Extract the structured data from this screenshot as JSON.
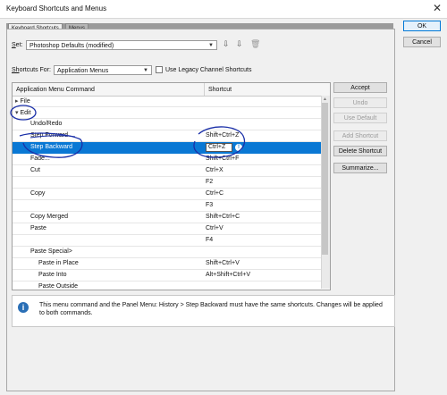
{
  "window": {
    "title": "Keyboard Shortcuts and Menus"
  },
  "tabs": [
    {
      "label": "Keyboard Shortcuts"
    },
    {
      "label": "Menus"
    }
  ],
  "set": {
    "label_prefix": "S",
    "label_rest": "et:",
    "value": "Photoshop Defaults (modified)"
  },
  "shortcuts_for": {
    "label_prefix": "Sh",
    "label_rest": "ortcuts For:",
    "value": "Application Menus",
    "legacy_label": "Use Legacy Channel Shortcuts"
  },
  "table": {
    "col_command": "Application Menu Command",
    "col_shortcut": "Shortcut",
    "rows": [
      {
        "cmd": "File",
        "sc": "",
        "indent": 0,
        "group": "collapsed"
      },
      {
        "cmd": "Edit",
        "sc": "",
        "indent": 0,
        "group": "expanded"
      },
      {
        "cmd": "Undo/Redo",
        "sc": "",
        "indent": 1
      },
      {
        "cmd": "Step Forward",
        "sc": "Shift+Ctrl+Z",
        "indent": 1
      },
      {
        "cmd": "Step Backward",
        "sc": "Ctrl+Z",
        "indent": 1,
        "selected": true
      },
      {
        "cmd": "Fade...",
        "sc": "Shift+Ctrl+F",
        "indent": 1
      },
      {
        "cmd": "Cut",
        "sc": "Ctrl+X",
        "indent": 1
      },
      {
        "cmd": "",
        "sc": "F2",
        "indent": 1
      },
      {
        "cmd": "Copy",
        "sc": "Ctrl+C",
        "indent": 1
      },
      {
        "cmd": "",
        "sc": "F3",
        "indent": 1
      },
      {
        "cmd": "Copy Merged",
        "sc": "Shift+Ctrl+C",
        "indent": 1
      },
      {
        "cmd": "Paste",
        "sc": "Ctrl+V",
        "indent": 1
      },
      {
        "cmd": "",
        "sc": "F4",
        "indent": 1
      },
      {
        "cmd": "Paste Special>",
        "sc": "",
        "indent": 1
      },
      {
        "cmd": "Paste in Place",
        "sc": "Shift+Ctrl+V",
        "indent": 2
      },
      {
        "cmd": "Paste Into",
        "sc": "Alt+Shift+Ctrl+V",
        "indent": 2
      },
      {
        "cmd": "Paste Outside",
        "sc": "",
        "indent": 2
      }
    ]
  },
  "buttons": {
    "ok": "OK",
    "cancel": "Cancel",
    "accept": "Accept",
    "undo": "Undo",
    "use_default": "Use Default",
    "add_shortcut": "Add Shortcut",
    "delete_shortcut": "Delete Shortcut",
    "summarize": "Summarize..."
  },
  "info": {
    "message": "This menu command and the Panel Menu: History > Step Backward must have the same shortcuts.  Changes will be applied to both commands."
  },
  "colors": {
    "selection": "#0a78d4",
    "annotation": "#1a2fa8"
  }
}
